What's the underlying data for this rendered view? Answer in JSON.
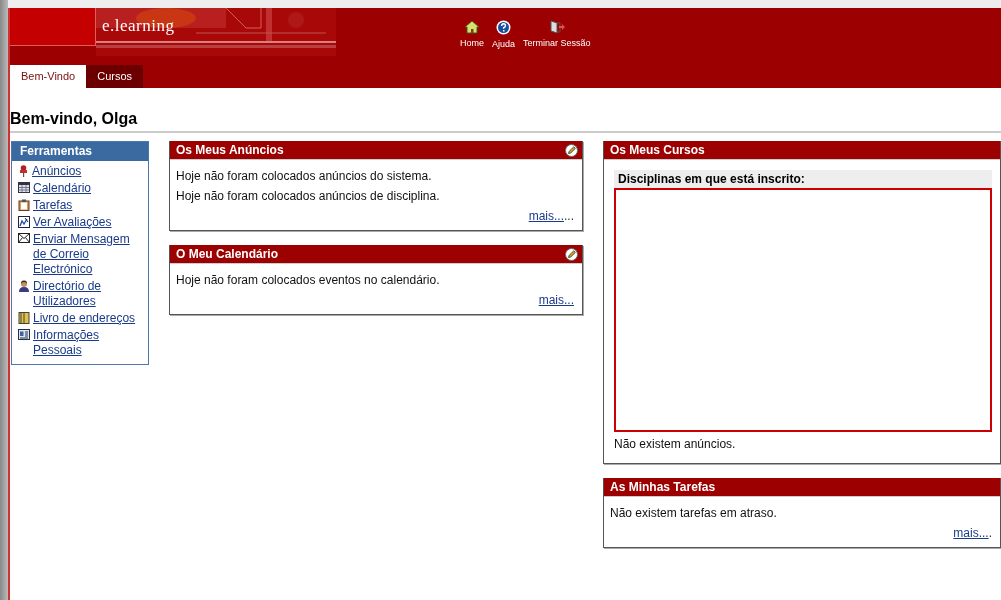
{
  "header": {
    "logo": "e.learning",
    "nav": [
      {
        "kind": "home",
        "label": "Home"
      },
      {
        "kind": "help",
        "label": "Ajuda"
      },
      {
        "kind": "logout",
        "label": "Terminar Sessão"
      }
    ]
  },
  "tabs": [
    {
      "label": "Bem-Vindo",
      "selected": true
    },
    {
      "label": "Cursos",
      "selected": false
    }
  ],
  "page_title": "Bem-vindo, Olga",
  "sidebar": {
    "title": "Ferramentas",
    "items": [
      {
        "kind": "pin",
        "label": "Anúncios"
      },
      {
        "kind": "calendar",
        "label": "Calendário"
      },
      {
        "kind": "clipboard",
        "label": "Tarefas"
      },
      {
        "kind": "chart",
        "label": "Ver Avaliações"
      },
      {
        "kind": "mail",
        "label": "Enviar Mensagem de Correio Electrónico"
      },
      {
        "kind": "person",
        "label": "Directório de Utilizadores"
      },
      {
        "kind": "book",
        "label": "Livro de endereços"
      },
      {
        "kind": "card",
        "label": "Informações Pessoais"
      }
    ]
  },
  "columns": [
    [
      {
        "kind": "messages",
        "title": "Os Meus Anúncios",
        "edit_icon": true,
        "lines": [
          "Hoje não foram colocados anúncios do sistema.",
          "Hoje não foram colocados anúncios de disciplina."
        ],
        "more": "mais...",
        "more_tail": "..."
      },
      {
        "kind": "messages",
        "title": "O Meu Calendário",
        "edit_icon": true,
        "lines": [
          "Hoje não foram colocados eventos no calendário."
        ],
        "more": "mais..."
      }
    ],
    [
      {
        "kind": "courses",
        "title": "Os Meus Cursos",
        "subheading": "Disciplinas em que está inscrito:",
        "lines": [
          "Não existem anúncios."
        ]
      },
      {
        "kind": "messages",
        "title": "As Minhas Tarefas",
        "lines": [
          "Não existem tarefas em atraso."
        ],
        "more": "mais...",
        "more_tail": "."
      }
    ]
  ]
}
